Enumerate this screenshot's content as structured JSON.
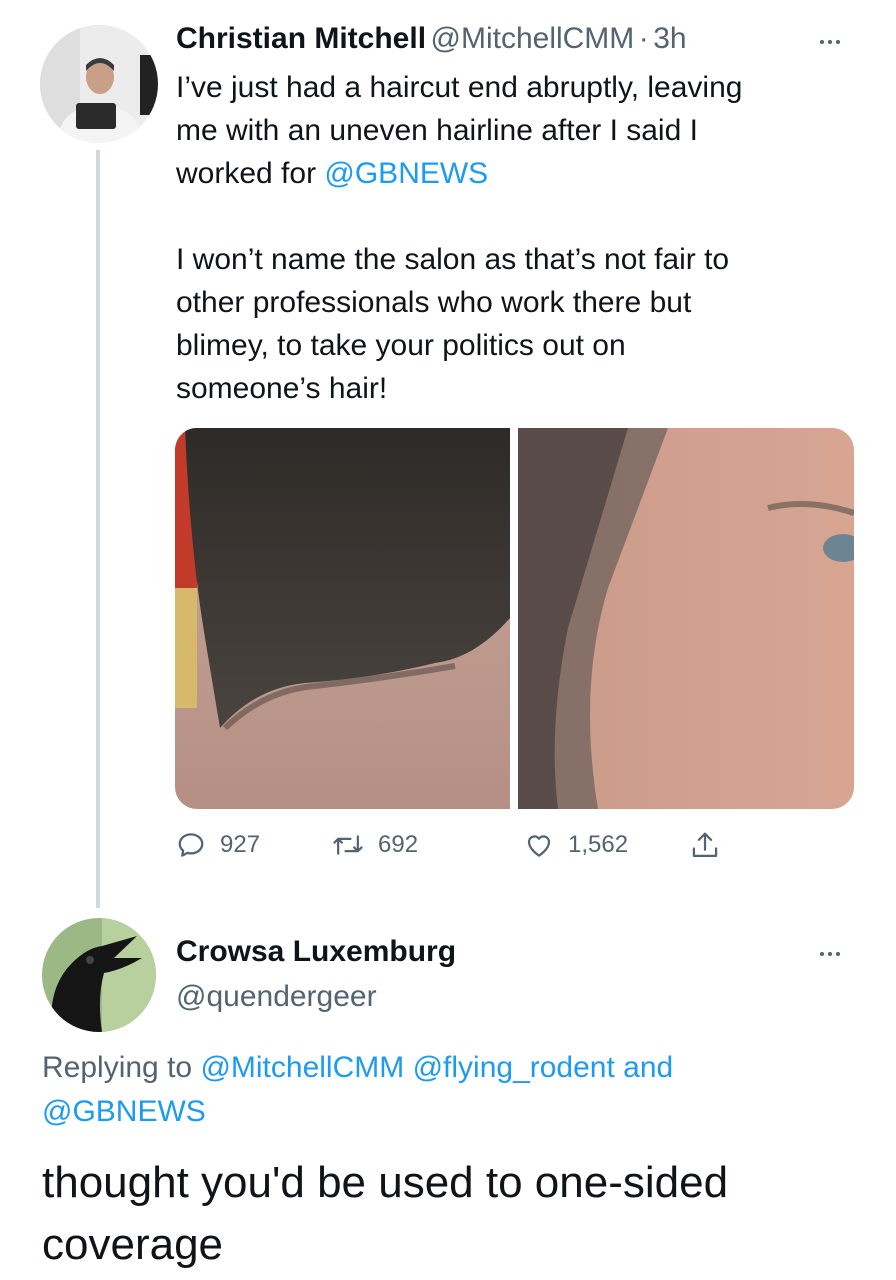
{
  "tweet": {
    "author_name": "Christian Mitchell",
    "author_handle": "@MitchellCMM",
    "separator": "·",
    "time": "3h",
    "text_lines": [
      "I’ve just had a haircut end abruptly, leaving",
      "me with an uneven hairline after I said I",
      "worked for "
    ],
    "mention": "@GBNEWS",
    "text_lines_2": [
      "I won’t name the salon as that’s not fair to",
      "other professionals who work there but",
      "blimey, to take your politics out on",
      "someone’s hair!"
    ],
    "stats": {
      "replies": "927",
      "retweets": "692",
      "likes": "1,562"
    },
    "icons": [
      "reply-icon",
      "retweet-icon",
      "like-icon",
      "share-icon",
      "more-icon"
    ]
  },
  "reply": {
    "author_name": "Crowsa Luxemburg",
    "author_handle": "@quendergeer",
    "replying_prefix": "Replying to ",
    "replying_mentions": [
      "@MitchellCMM",
      "@flying_rodent"
    ],
    "replying_and": " and",
    "replying_last": "@GBNEWS",
    "text_lines": [
      "thought you'd be used to one-sided",
      "coverage"
    ]
  },
  "colors": {
    "link": "#1d9bf0",
    "text": "#0f1419",
    "secondary": "#536471",
    "thread_line": "#cfd9de"
  }
}
